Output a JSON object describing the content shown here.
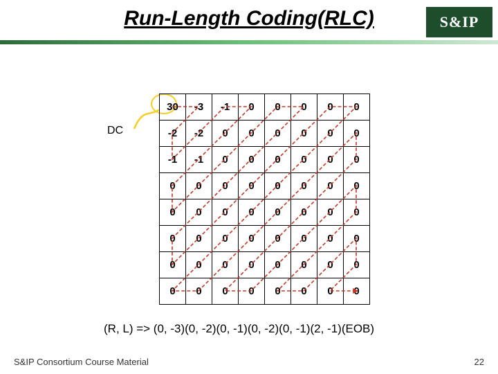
{
  "title": "Run-Length Coding(RLC)",
  "logo_text": "S&IP",
  "dc_label": "DC",
  "chart_data": {
    "type": "table",
    "title": "8x8 DCT coefficient block with zig-zag scan",
    "rows": [
      [
        30,
        -3,
        -1,
        0,
        0,
        0,
        0,
        0
      ],
      [
        -2,
        -2,
        0,
        0,
        0,
        0,
        0,
        0
      ],
      [
        -1,
        -1,
        0,
        0,
        0,
        0,
        0,
        0
      ],
      [
        0,
        0,
        0,
        0,
        0,
        0,
        0,
        0
      ],
      [
        0,
        0,
        0,
        0,
        0,
        0,
        0,
        0
      ],
      [
        0,
        0,
        0,
        0,
        0,
        0,
        0,
        0
      ],
      [
        0,
        0,
        0,
        0,
        0,
        0,
        0,
        0
      ],
      [
        0,
        0,
        0,
        0,
        0,
        0,
        0,
        0
      ]
    ]
  },
  "rl_formula": "(R, L) => (0, -3)(0, -2)(0, -1)(0, -2)(0, -1)(2, -1)(EOB)",
  "footer": "S&IP Consortium Course Material",
  "page_number": "22"
}
